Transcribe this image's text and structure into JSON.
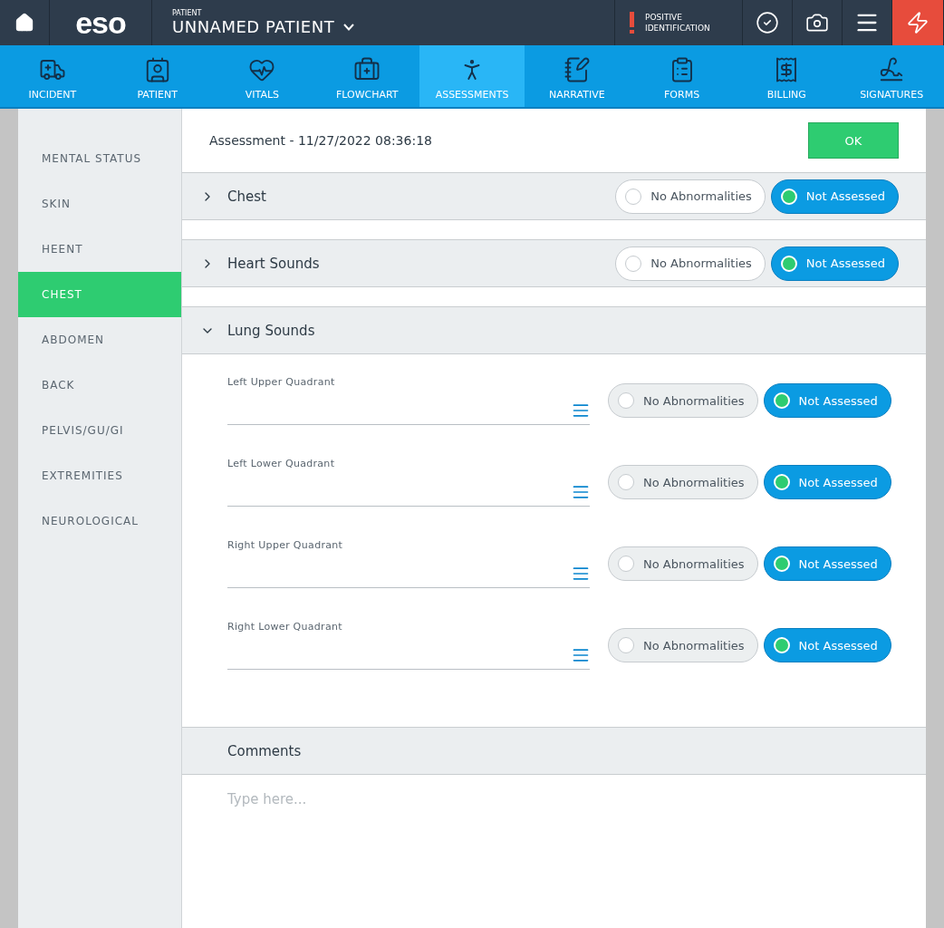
{
  "header": {
    "logo": "eso",
    "patient_label": "PATIENT",
    "patient_name": "UNNAMED PATIENT",
    "alert_lines": [
      "POSITIVE",
      "IDENTIFICATION"
    ]
  },
  "nav": [
    {
      "label": "INCIDENT",
      "selected": false
    },
    {
      "label": "PATIENT",
      "selected": false
    },
    {
      "label": "VITALS",
      "selected": false
    },
    {
      "label": "FLOWCHART",
      "selected": false
    },
    {
      "label": "ASSESSMENTS",
      "selected": true
    },
    {
      "label": "NARRATIVE",
      "selected": false
    },
    {
      "label": "FORMS",
      "selected": false
    },
    {
      "label": "BILLING",
      "selected": false
    },
    {
      "label": "SIGNATURES",
      "selected": false
    }
  ],
  "sidebar": {
    "items": [
      {
        "label": "MENTAL STATUS",
        "selected": false
      },
      {
        "label": "SKIN",
        "selected": false
      },
      {
        "label": "HEENT",
        "selected": false
      },
      {
        "label": "CHEST",
        "selected": true
      },
      {
        "label": "ABDOMEN",
        "selected": false
      },
      {
        "label": "BACK",
        "selected": false
      },
      {
        "label": "PELVIS/GU/GI",
        "selected": false
      },
      {
        "label": "EXTREMITIES",
        "selected": false
      },
      {
        "label": "NEUROLOGICAL",
        "selected": false
      }
    ]
  },
  "assessment": {
    "title": "Assessment - 11/27/2022 08:36:18",
    "ok_button": "OK"
  },
  "sections": [
    {
      "title": "Chest",
      "expanded": false,
      "options": [
        {
          "label": "No Abnormalities",
          "selected": false
        },
        {
          "label": "Not Assessed",
          "selected": true
        }
      ]
    },
    {
      "title": "Heart Sounds",
      "expanded": false,
      "options": [
        {
          "label": "No Abnormalities",
          "selected": false
        },
        {
          "label": "Not Assessed",
          "selected": true
        }
      ]
    },
    {
      "title": "Lung Sounds",
      "expanded": true,
      "fields": [
        {
          "label": "Left Upper Quadrant",
          "options": [
            {
              "label": "No Abnormalities",
              "selected": false
            },
            {
              "label": "Not Assessed",
              "selected": true
            }
          ]
        },
        {
          "label": "Left Lower Quadrant",
          "options": [
            {
              "label": "No Abnormalities",
              "selected": false
            },
            {
              "label": "Not Assessed",
              "selected": true
            }
          ]
        },
        {
          "label": "Right Upper Quadrant",
          "options": [
            {
              "label": "No Abnormalities",
              "selected": false
            },
            {
              "label": "Not Assessed",
              "selected": true
            }
          ]
        },
        {
          "label": "Right Lower Quadrant",
          "options": [
            {
              "label": "No Abnormalities",
              "selected": false
            },
            {
              "label": "Not Assessed",
              "selected": true
            }
          ]
        }
      ]
    }
  ],
  "comments": {
    "title": "Comments",
    "placeholder": "Type here..."
  }
}
